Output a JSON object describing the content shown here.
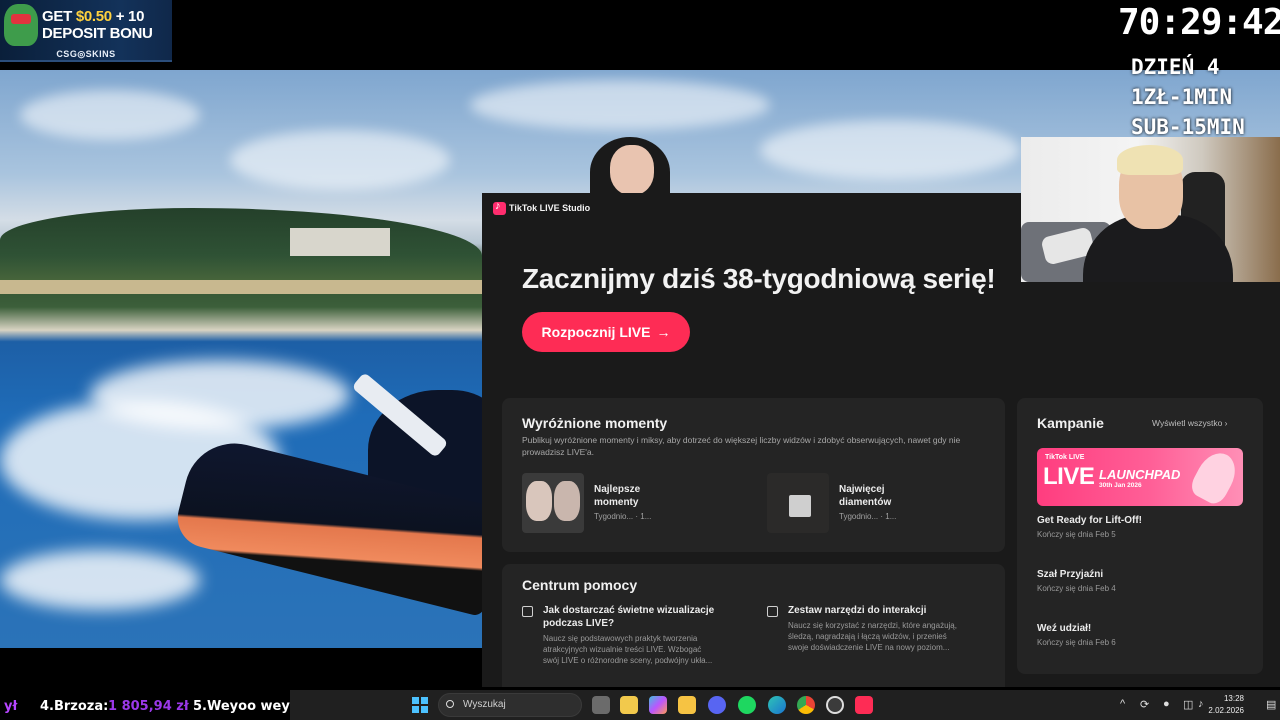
{
  "ad": {
    "headline_a": "GET ",
    "headline_b": "$0.50",
    "headline_c": " + 10",
    "headline_d": "DEPOSIT BONU",
    "brand": "CSG◎SKINS"
  },
  "stream": {
    "timer": "70:29:42",
    "line1": "DZIEŃ 4",
    "line2": "1ZŁ-1MIN",
    "line3": "SUB-15MIN"
  },
  "tiktok": {
    "window_title": "TikTok LIVE Studio",
    "headline": "Zacznijmy dziś 38-tygodniową serię!",
    "start_button": "Rozpocznij LIVE",
    "start_arrow": "→",
    "highlights": {
      "title": "Wyróżnione momenty",
      "description": "Publikuj wyróżnione momenty i miksy, aby dotrzeć do większej liczby widzów i zdobyć obserwujących, nawet gdy nie prowadzisz LIVE'a.",
      "items": [
        {
          "label": "Najlepsze\nmomenty",
          "meta": "Tygodnio...   · 1..."
        },
        {
          "label": "Najwięcej\ndiamentów",
          "meta": "Tygodnio...   · 1..."
        }
      ]
    },
    "help": {
      "title": "Centrum pomocy",
      "items": [
        {
          "title": "Jak dostarczać świetne wizualizacje\npodczas LIVE?",
          "desc": "Naucz się podstawowych praktyk tworzenia\natrakcyjnych wizualnie treści LIVE. Wzbogać\nswój LIVE o różnorodne sceny, podwójny ukła..."
        },
        {
          "title": "Zestaw narzędzi do interakcji",
          "desc": "Naucz się korzystać z narzędzi, które angażują,\nśledzą, nagradzają i łączą widzów, i przenieś\nswoje doświadczenie LIVE na nowy poziom..."
        }
      ]
    },
    "campaigns": {
      "title": "Kampanie",
      "view_all": "Wyświetl wszystko",
      "banner_small": "TikTok LIVE",
      "banner_big": "LIVE",
      "banner_launch": "LAUNCHPAD",
      "banner_date": "30th Jan 2026",
      "items": [
        {
          "title": "Get Ready for Lift-Off!",
          "sub": "Kończy się dnia Feb 5"
        },
        {
          "title": "Szał Przyjaźni",
          "sub": "Kończy się dnia Feb 4"
        },
        {
          "title": "Weź udział!",
          "sub": "Kończy się dnia Feb 6"
        }
      ]
    }
  },
  "ticker": {
    "a": "ył",
    "b": "4.Brzoza:",
    "c": "1 805,94 zł",
    "d": "5.Weyoo wey"
  },
  "taskbar": {
    "search_placeholder": "Wyszukaj",
    "time": "13:28",
    "date": "2.02.2026",
    "apps": [
      "file-explorer",
      "store",
      "copilot",
      "folder",
      "discord",
      "spotify",
      "edge",
      "chrome",
      "obs",
      "tiktok"
    ]
  }
}
